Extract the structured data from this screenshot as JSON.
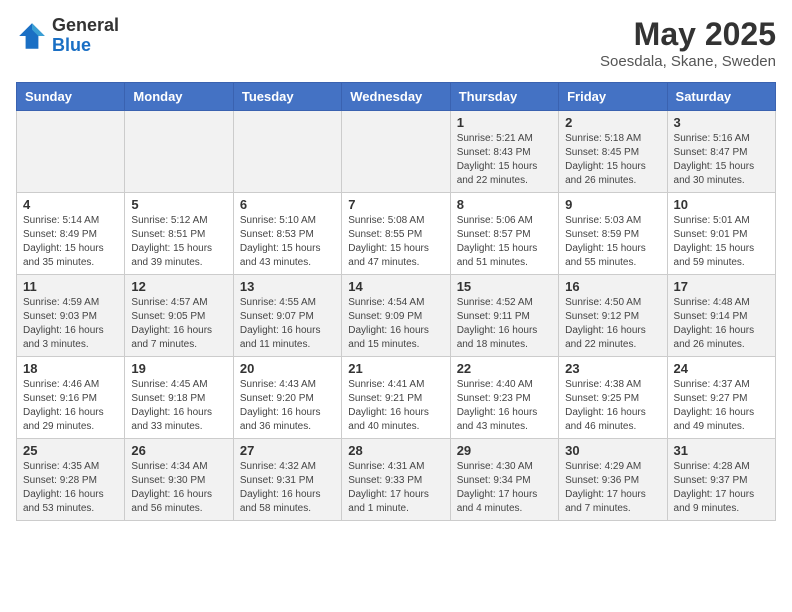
{
  "header": {
    "logo_general": "General",
    "logo_blue": "Blue",
    "month_title": "May 2025",
    "location": "Soesdala, Skane, Sweden"
  },
  "weekdays": [
    "Sunday",
    "Monday",
    "Tuesday",
    "Wednesday",
    "Thursday",
    "Friday",
    "Saturday"
  ],
  "weeks": [
    [
      {
        "day": "",
        "info": ""
      },
      {
        "day": "",
        "info": ""
      },
      {
        "day": "",
        "info": ""
      },
      {
        "day": "",
        "info": ""
      },
      {
        "day": "1",
        "info": "Sunrise: 5:21 AM\nSunset: 8:43 PM\nDaylight: 15 hours\nand 22 minutes."
      },
      {
        "day": "2",
        "info": "Sunrise: 5:18 AM\nSunset: 8:45 PM\nDaylight: 15 hours\nand 26 minutes."
      },
      {
        "day": "3",
        "info": "Sunrise: 5:16 AM\nSunset: 8:47 PM\nDaylight: 15 hours\nand 30 minutes."
      }
    ],
    [
      {
        "day": "4",
        "info": "Sunrise: 5:14 AM\nSunset: 8:49 PM\nDaylight: 15 hours\nand 35 minutes."
      },
      {
        "day": "5",
        "info": "Sunrise: 5:12 AM\nSunset: 8:51 PM\nDaylight: 15 hours\nand 39 minutes."
      },
      {
        "day": "6",
        "info": "Sunrise: 5:10 AM\nSunset: 8:53 PM\nDaylight: 15 hours\nand 43 minutes."
      },
      {
        "day": "7",
        "info": "Sunrise: 5:08 AM\nSunset: 8:55 PM\nDaylight: 15 hours\nand 47 minutes."
      },
      {
        "day": "8",
        "info": "Sunrise: 5:06 AM\nSunset: 8:57 PM\nDaylight: 15 hours\nand 51 minutes."
      },
      {
        "day": "9",
        "info": "Sunrise: 5:03 AM\nSunset: 8:59 PM\nDaylight: 15 hours\nand 55 minutes."
      },
      {
        "day": "10",
        "info": "Sunrise: 5:01 AM\nSunset: 9:01 PM\nDaylight: 15 hours\nand 59 minutes."
      }
    ],
    [
      {
        "day": "11",
        "info": "Sunrise: 4:59 AM\nSunset: 9:03 PM\nDaylight: 16 hours\nand 3 minutes."
      },
      {
        "day": "12",
        "info": "Sunrise: 4:57 AM\nSunset: 9:05 PM\nDaylight: 16 hours\nand 7 minutes."
      },
      {
        "day": "13",
        "info": "Sunrise: 4:55 AM\nSunset: 9:07 PM\nDaylight: 16 hours\nand 11 minutes."
      },
      {
        "day": "14",
        "info": "Sunrise: 4:54 AM\nSunset: 9:09 PM\nDaylight: 16 hours\nand 15 minutes."
      },
      {
        "day": "15",
        "info": "Sunrise: 4:52 AM\nSunset: 9:11 PM\nDaylight: 16 hours\nand 18 minutes."
      },
      {
        "day": "16",
        "info": "Sunrise: 4:50 AM\nSunset: 9:12 PM\nDaylight: 16 hours\nand 22 minutes."
      },
      {
        "day": "17",
        "info": "Sunrise: 4:48 AM\nSunset: 9:14 PM\nDaylight: 16 hours\nand 26 minutes."
      }
    ],
    [
      {
        "day": "18",
        "info": "Sunrise: 4:46 AM\nSunset: 9:16 PM\nDaylight: 16 hours\nand 29 minutes."
      },
      {
        "day": "19",
        "info": "Sunrise: 4:45 AM\nSunset: 9:18 PM\nDaylight: 16 hours\nand 33 minutes."
      },
      {
        "day": "20",
        "info": "Sunrise: 4:43 AM\nSunset: 9:20 PM\nDaylight: 16 hours\nand 36 minutes."
      },
      {
        "day": "21",
        "info": "Sunrise: 4:41 AM\nSunset: 9:21 PM\nDaylight: 16 hours\nand 40 minutes."
      },
      {
        "day": "22",
        "info": "Sunrise: 4:40 AM\nSunset: 9:23 PM\nDaylight: 16 hours\nand 43 minutes."
      },
      {
        "day": "23",
        "info": "Sunrise: 4:38 AM\nSunset: 9:25 PM\nDaylight: 16 hours\nand 46 minutes."
      },
      {
        "day": "24",
        "info": "Sunrise: 4:37 AM\nSunset: 9:27 PM\nDaylight: 16 hours\nand 49 minutes."
      }
    ],
    [
      {
        "day": "25",
        "info": "Sunrise: 4:35 AM\nSunset: 9:28 PM\nDaylight: 16 hours\nand 53 minutes."
      },
      {
        "day": "26",
        "info": "Sunrise: 4:34 AM\nSunset: 9:30 PM\nDaylight: 16 hours\nand 56 minutes."
      },
      {
        "day": "27",
        "info": "Sunrise: 4:32 AM\nSunset: 9:31 PM\nDaylight: 16 hours\nand 58 minutes."
      },
      {
        "day": "28",
        "info": "Sunrise: 4:31 AM\nSunset: 9:33 PM\nDaylight: 17 hours\nand 1 minute."
      },
      {
        "day": "29",
        "info": "Sunrise: 4:30 AM\nSunset: 9:34 PM\nDaylight: 17 hours\nand 4 minutes."
      },
      {
        "day": "30",
        "info": "Sunrise: 4:29 AM\nSunset: 9:36 PM\nDaylight: 17 hours\nand 7 minutes."
      },
      {
        "day": "31",
        "info": "Sunrise: 4:28 AM\nSunset: 9:37 PM\nDaylight: 17 hours\nand 9 minutes."
      }
    ]
  ]
}
